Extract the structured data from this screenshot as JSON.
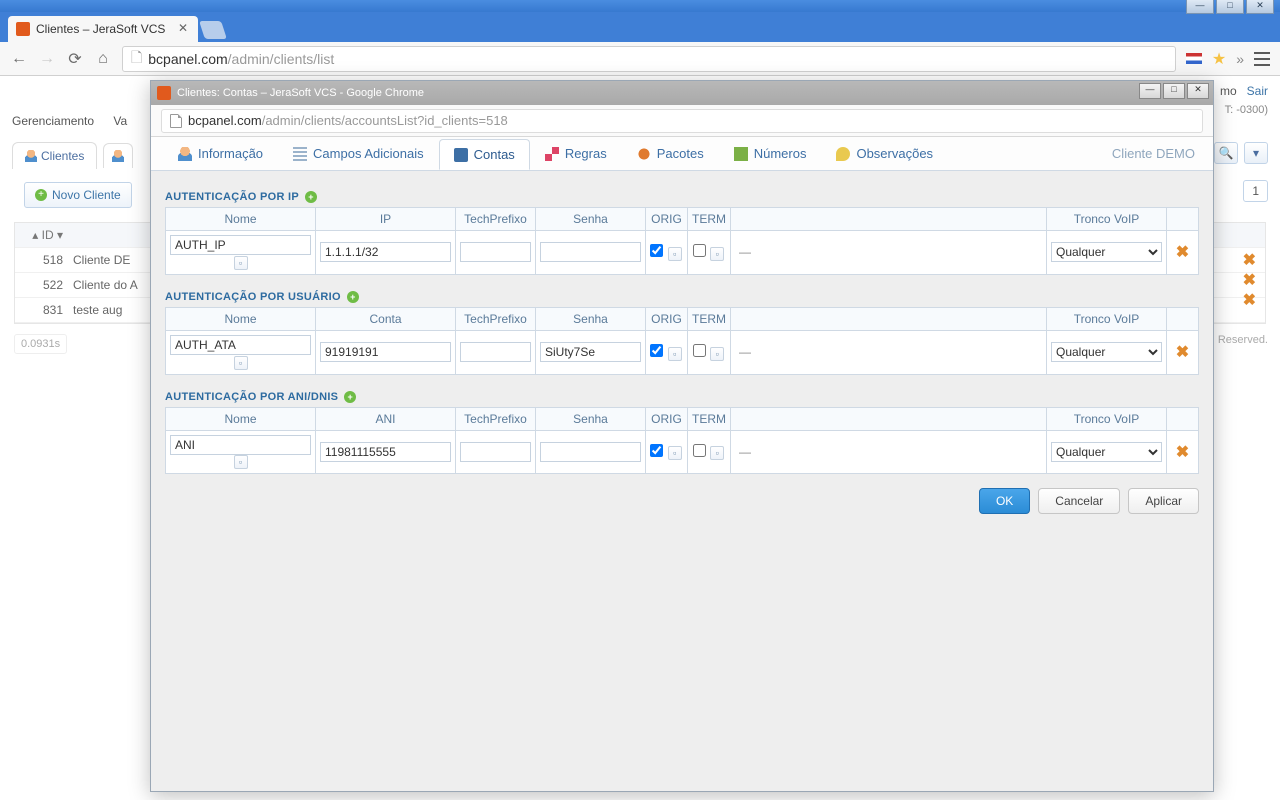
{
  "outer_window": {
    "tab_title": "Clientes – JeraSoft VCS",
    "url_domain": "bcpanel.com",
    "url_path": "/admin/clients/list"
  },
  "main_page": {
    "top_right": {
      "mo": "mo",
      "sair": "Sair",
      "tz": "T: -0300)"
    },
    "menu": {
      "gerenciamento": "Gerenciamento",
      "va": "Va"
    },
    "tabs": {
      "clientes": "Clientes"
    },
    "novo_cliente": "Novo Cliente",
    "page_one": "1",
    "table": {
      "hdr_id": "ID",
      "rows": [
        {
          "id": "518",
          "name": "Cliente DE"
        },
        {
          "id": "522",
          "name": "Cliente do A"
        },
        {
          "id": "831",
          "name": "teste aug"
        }
      ]
    },
    "timer": "0.0931s",
    "footer": "Reserved."
  },
  "dialog": {
    "title": "Clientes: Contas – JeraSoft VCS - Google Chrome",
    "url_domain": "bcpanel.com",
    "url_path": "/admin/clients/accountsList?id_clients=518",
    "client_name": "Cliente DEMO",
    "tabs": {
      "info": "Informação",
      "campos": "Campos Adicionais",
      "contas": "Contas",
      "regras": "Regras",
      "pacotes": "Pacotes",
      "numeros": "Números",
      "obs": "Observações"
    },
    "sections": {
      "ip": {
        "title": "AUTENTICAÇÃO POR IP",
        "headers": {
          "nome": "Nome",
          "ip": "IP",
          "pref": "TechPrefixo",
          "senha": "Senha",
          "orig": "ORIG",
          "term": "TERM",
          "tronco": "Tronco VoIP"
        },
        "row": {
          "nome": "AUTH_IP",
          "ip": "1.1.1.1/32",
          "pref": "",
          "senha": "",
          "orig_checked": true,
          "term_checked": false,
          "extra": "—",
          "tronco": "Qualquer"
        }
      },
      "user": {
        "title": "AUTENTICAÇÃO POR USUÁRIO",
        "headers": {
          "nome": "Nome",
          "conta": "Conta",
          "pref": "TechPrefixo",
          "senha": "Senha",
          "orig": "ORIG",
          "term": "TERM",
          "tronco": "Tronco VoIP"
        },
        "row": {
          "nome": "AUTH_ATA",
          "conta": "91919191",
          "pref": "",
          "senha": "SiUty7Se",
          "orig_checked": true,
          "term_checked": false,
          "extra": "—",
          "tronco": "Qualquer"
        }
      },
      "ani": {
        "title": "AUTENTICAÇÃO POR ANI/DNIS",
        "headers": {
          "nome": "Nome",
          "ani": "ANI",
          "pref": "TechPrefixo",
          "senha": "Senha",
          "orig": "ORIG",
          "term": "TERM",
          "tronco": "Tronco VoIP"
        },
        "row": {
          "nome": "ANI",
          "ani": "11981115555",
          "pref": "",
          "senha": "",
          "orig_checked": true,
          "term_checked": false,
          "extra": "—",
          "tronco": "Qualquer"
        }
      }
    },
    "buttons": {
      "ok": "OK",
      "cancel": "Cancelar",
      "apply": "Aplicar"
    }
  }
}
